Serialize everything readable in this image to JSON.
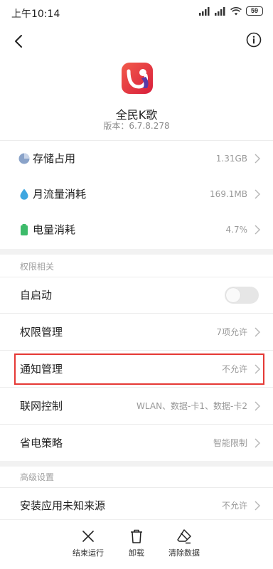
{
  "status_bar": {
    "time": "上午10:14",
    "battery": "59"
  },
  "app": {
    "name": "全民K歌",
    "version": "版本：6.7.8.278"
  },
  "usage_rows": [
    {
      "label": "存储占用",
      "value": "1.31GB",
      "icon": "pie-chart-icon"
    },
    {
      "label": "月流量消耗",
      "value": "169.1MB",
      "icon": "water-drop-icon"
    },
    {
      "label": "电量消耗",
      "value": "4.7%",
      "icon": "battery-icon"
    }
  ],
  "permission_section": {
    "title": "权限相关",
    "autostart": {
      "label": "自启动",
      "enabled": false
    },
    "rows": [
      {
        "label": "权限管理",
        "value": "7项允许"
      },
      {
        "label": "通知管理",
        "value": "不允许"
      },
      {
        "label": "联网控制",
        "value": "WLAN、数据-卡1、数据-卡2"
      },
      {
        "label": "省电策略",
        "value": "智能限制"
      }
    ]
  },
  "advanced_section": {
    "title": "高级设置",
    "rows": [
      {
        "label": "安装应用未知来源",
        "value": "不允许"
      }
    ]
  },
  "bottom_actions": [
    {
      "label": "结束运行",
      "icon": "close-x-icon"
    },
    {
      "label": "卸载",
      "icon": "trash-icon"
    },
    {
      "label": "清除数据",
      "icon": "eraser-icon"
    }
  ],
  "colors": {
    "highlight": "#e53935",
    "brand": "#e8352b"
  }
}
